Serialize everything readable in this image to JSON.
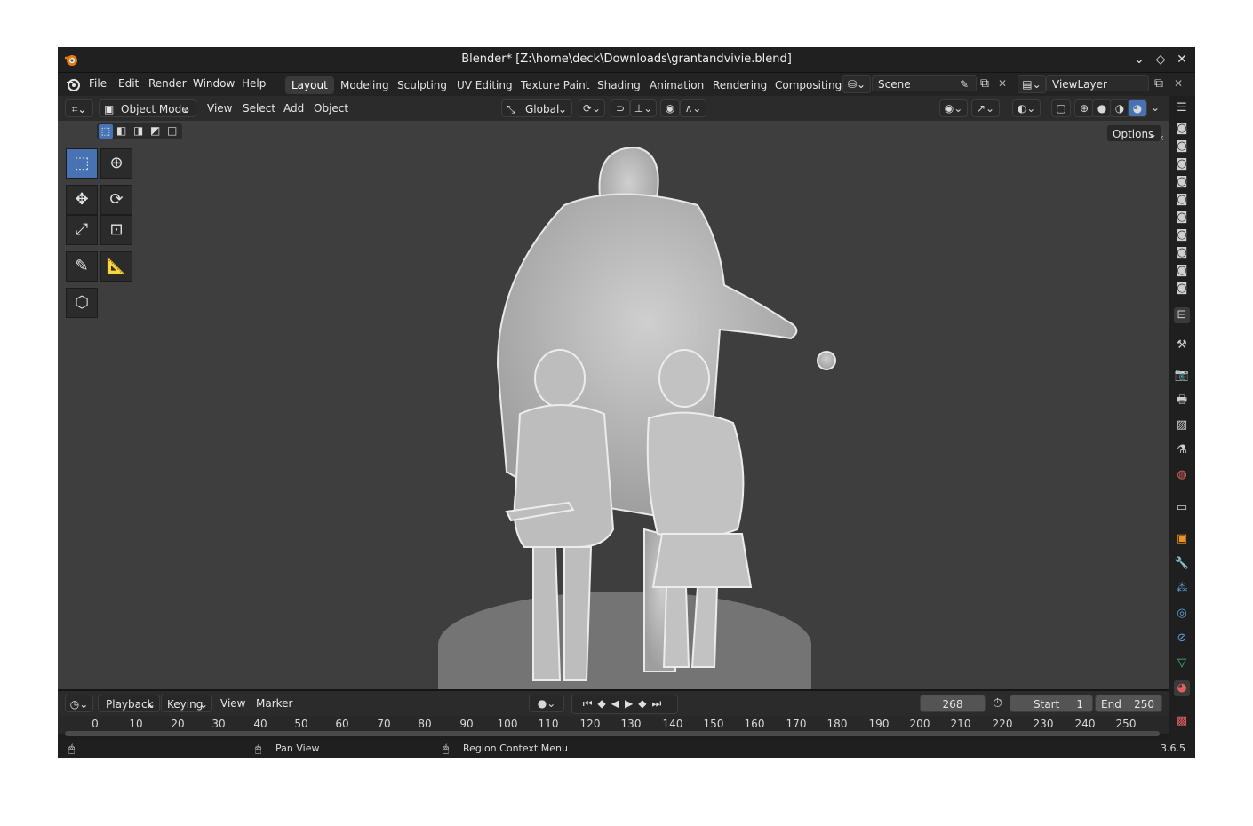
{
  "window": {
    "title": "Blender* [Z:\\home\\deck\\Downloads\\grantandvivie.blend]",
    "controls": [
      "chevron-down",
      "restore",
      "close"
    ]
  },
  "menubar": {
    "items": [
      "File",
      "Edit",
      "Render",
      "Window",
      "Help"
    ],
    "workspaces": [
      "Layout",
      "Modeling",
      "Sculpting",
      "UV Editing",
      "Texture Paint",
      "Shading",
      "Animation",
      "Rendering",
      "Compositing"
    ],
    "active_workspace": "Layout",
    "scene": "Scene",
    "view_layer": "ViewLayer"
  },
  "header": {
    "mode": "Object Mode",
    "menus": [
      "View",
      "Select",
      "Add",
      "Object"
    ],
    "transform_orientation": "Global",
    "options_label": "Options"
  },
  "tools": [
    "select-box",
    "cursor",
    "move",
    "rotate",
    "scale",
    "transform",
    "annotate",
    "measure",
    "add-cube"
  ],
  "timeline": {
    "menus": [
      "Playback",
      "Keying",
      "View",
      "Marker"
    ],
    "current_frame": "268",
    "start_label": "Start",
    "start_value": "1",
    "end_label": "End",
    "end_value": "250",
    "ruler": [
      "0",
      "10",
      "20",
      "30",
      "40",
      "50",
      "60",
      "70",
      "80",
      "90",
      "100",
      "110",
      "120",
      "130",
      "140",
      "150",
      "160",
      "170",
      "180",
      "190",
      "200",
      "210",
      "220",
      "230",
      "240",
      "250"
    ]
  },
  "statusbar": {
    "pan_view": "Pan View",
    "region_menu": "Region Context Menu",
    "version": "3.6.5"
  },
  "colors": {
    "accent": "#4772b3",
    "viewport": "#3e3e3e",
    "model": "#b9b9b9"
  }
}
